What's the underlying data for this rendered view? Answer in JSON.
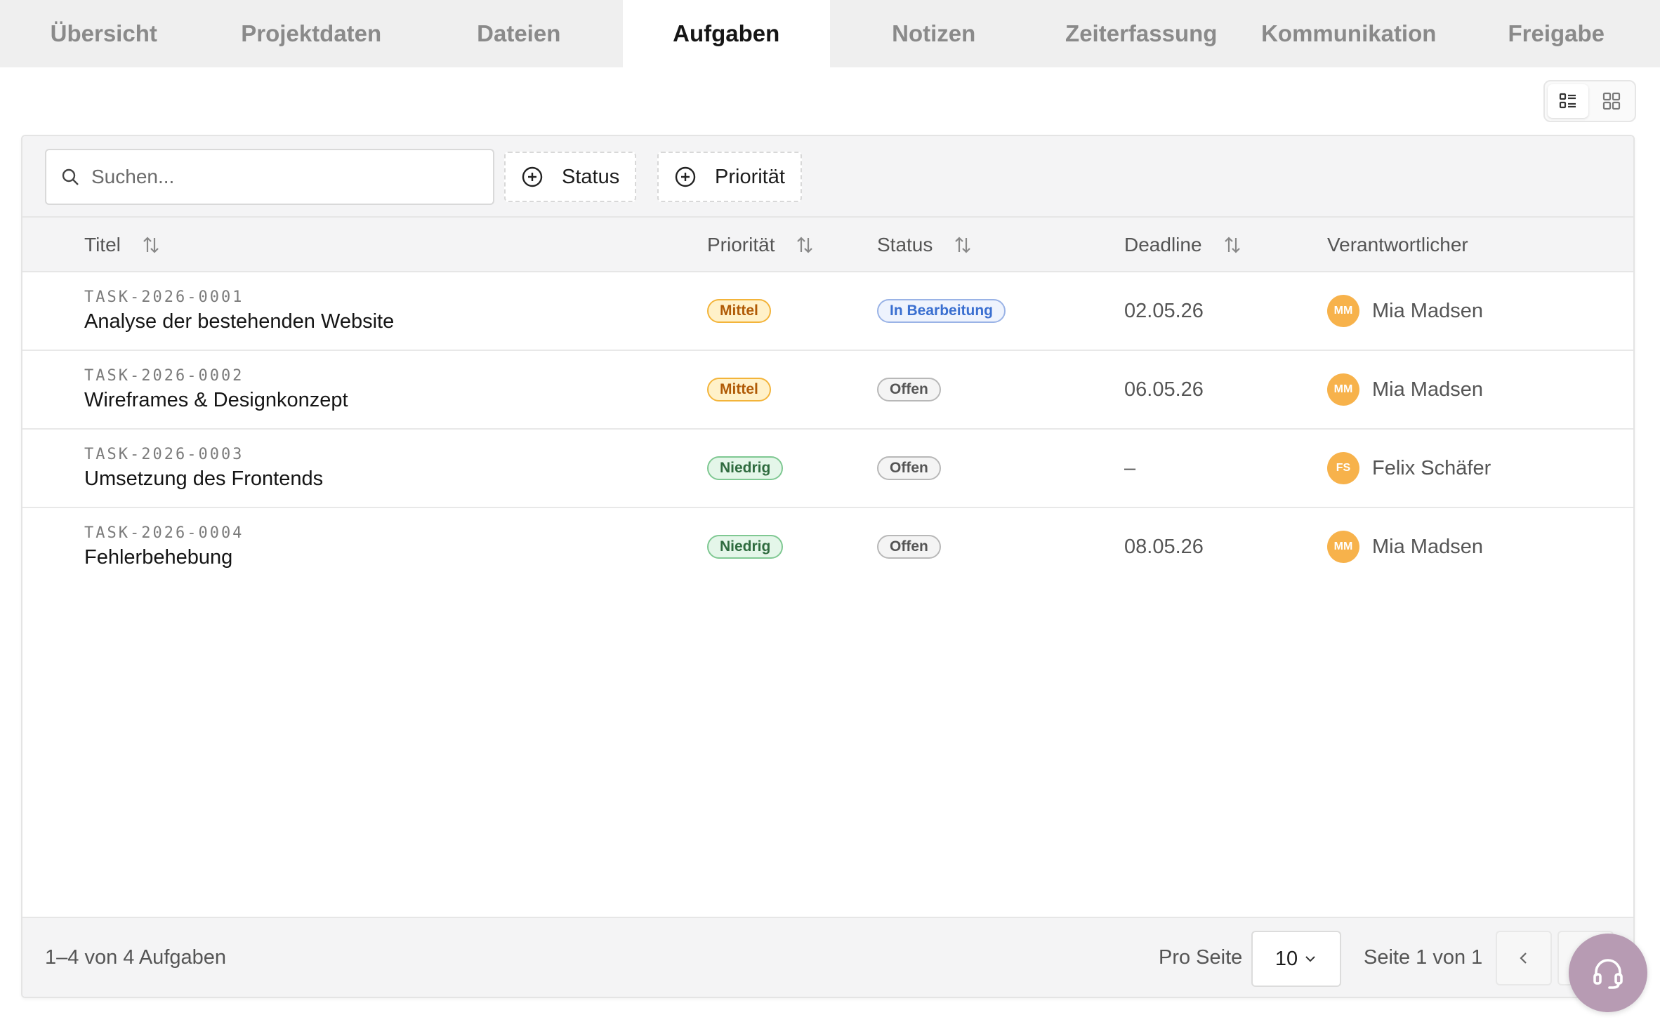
{
  "tabs": [
    {
      "label": "Übersicht"
    },
    {
      "label": "Projektdaten"
    },
    {
      "label": "Dateien"
    },
    {
      "label": "Aufgaben"
    },
    {
      "label": "Notizen"
    },
    {
      "label": "Zeiterfassung"
    },
    {
      "label": "Kommunikation"
    },
    {
      "label": "Freigabe"
    }
  ],
  "active_tab": "Aufgaben",
  "view_toggle": {
    "list_icon": "list-view-icon",
    "grid_icon": "grid-view-icon",
    "active": "list"
  },
  "toolbar": {
    "search_placeholder": "Suchen...",
    "filter_status": "Status",
    "filter_priority": "Priorität"
  },
  "table": {
    "headers": {
      "title": "Titel",
      "priority": "Priorität",
      "status": "Status",
      "deadline": "Deadline",
      "owner": "Verantwortlicher"
    },
    "rows": [
      {
        "id": "TASK-2026-0001",
        "title": "Analyse der bestehenden Website",
        "priority": "Mittel",
        "status": "In Bearbeitung",
        "deadline": "02.05.26",
        "owner_initials": "MM",
        "owner": "Mia Madsen"
      },
      {
        "id": "TASK-2026-0002",
        "title": "Wireframes & Designkonzept",
        "priority": "Mittel",
        "status": "Offen",
        "deadline": "06.05.26",
        "owner_initials": "MM",
        "owner": "Mia Madsen"
      },
      {
        "id": "TASK-2026-0003",
        "title": "Umsetzung des Frontends",
        "priority": "Niedrig",
        "status": "Offen",
        "deadline": "–",
        "owner_initials": "FS",
        "owner": "Felix Schäfer"
      },
      {
        "id": "TASK-2026-0004",
        "title": "Fehlerbehebung",
        "priority": "Niedrig",
        "status": "Offen",
        "deadline": "08.05.26",
        "owner_initials": "MM",
        "owner": "Mia Madsen"
      }
    ]
  },
  "footer": {
    "count_text": "1–4 von 4 Aufgaben",
    "per_page_label": "Pro Seite",
    "per_page_value": "10",
    "page_text": "Seite 1 von 1"
  },
  "colors": {
    "priority_mittel": "#f3b43a",
    "priority_niedrig": "#7fc892",
    "status_in_bearbeitung": "#3a6fd0",
    "status_offen": "#b8b8b8",
    "avatar": "#f7b24b",
    "help_fab": "#b79bb3"
  }
}
